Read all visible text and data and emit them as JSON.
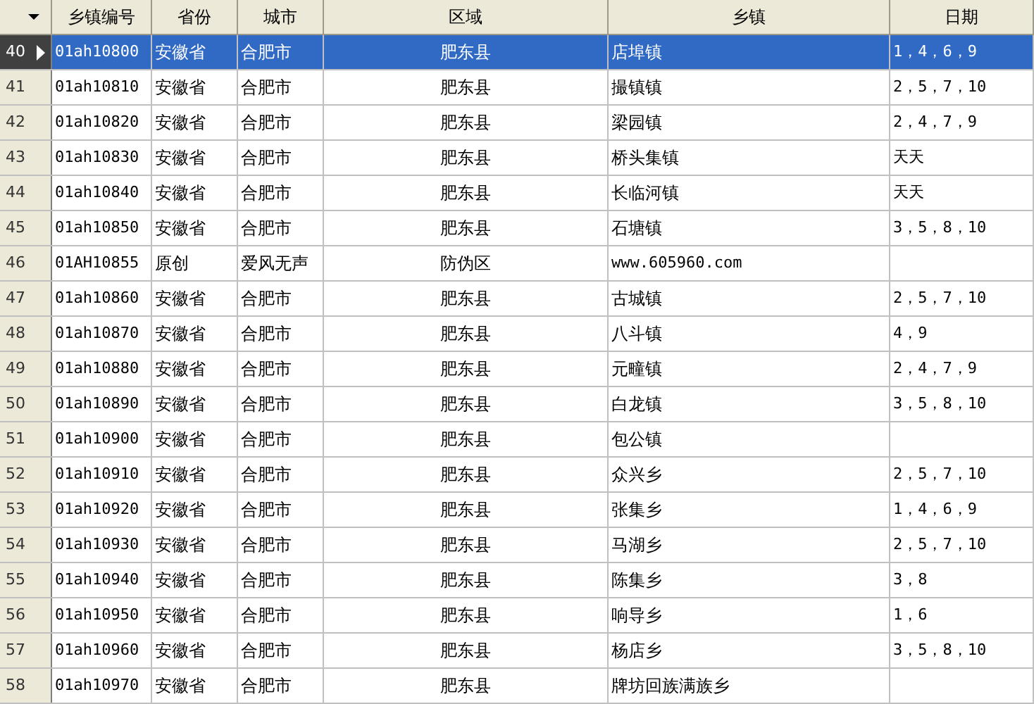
{
  "table": {
    "columns": [
      "乡镇编号",
      "省份",
      "城市",
      "区域",
      "乡镇",
      "日期"
    ],
    "rows": [
      {
        "number": "40",
        "selected": true,
        "cells": [
          "01ah10800",
          "安徽省",
          "合肥市",
          "肥东县",
          "店埠镇",
          "1，4，6，9"
        ]
      },
      {
        "number": "41",
        "selected": false,
        "cells": [
          "01ah10810",
          "安徽省",
          "合肥市",
          "肥东县",
          "撮镇镇",
          "2，5，7，10"
        ]
      },
      {
        "number": "42",
        "selected": false,
        "cells": [
          "01ah10820",
          "安徽省",
          "合肥市",
          "肥东县",
          "梁园镇",
          "2，4，7，9"
        ]
      },
      {
        "number": "43",
        "selected": false,
        "cells": [
          "01ah10830",
          "安徽省",
          "合肥市",
          "肥东县",
          "桥头集镇",
          "天天"
        ]
      },
      {
        "number": "44",
        "selected": false,
        "cells": [
          "01ah10840",
          "安徽省",
          "合肥市",
          "肥东县",
          "长临河镇",
          "天天"
        ]
      },
      {
        "number": "45",
        "selected": false,
        "cells": [
          "01ah10850",
          "安徽省",
          "合肥市",
          "肥东县",
          "石塘镇",
          "3，5，8，10"
        ]
      },
      {
        "number": "46",
        "selected": false,
        "cells": [
          "01AH10855",
          "原创",
          "爱风无声",
          "防伪区",
          "www.605960.com",
          ""
        ]
      },
      {
        "number": "47",
        "selected": false,
        "cells": [
          "01ah10860",
          "安徽省",
          "合肥市",
          "肥东县",
          "古城镇",
          "2，5，7，10"
        ]
      },
      {
        "number": "48",
        "selected": false,
        "cells": [
          "01ah10870",
          "安徽省",
          "合肥市",
          "肥东县",
          "八斗镇",
          "4，9"
        ]
      },
      {
        "number": "49",
        "selected": false,
        "cells": [
          "01ah10880",
          "安徽省",
          "合肥市",
          "肥东县",
          "元疃镇",
          "2，4，7，9"
        ]
      },
      {
        "number": "50",
        "selected": false,
        "cells": [
          "01ah10890",
          "安徽省",
          "合肥市",
          "肥东县",
          "白龙镇",
          "3，5，8，10"
        ]
      },
      {
        "number": "51",
        "selected": false,
        "cells": [
          "01ah10900",
          "安徽省",
          "合肥市",
          "肥东县",
          "包公镇",
          ""
        ]
      },
      {
        "number": "52",
        "selected": false,
        "cells": [
          "01ah10910",
          "安徽省",
          "合肥市",
          "肥东县",
          "众兴乡",
          "2，5，7，10"
        ]
      },
      {
        "number": "53",
        "selected": false,
        "cells": [
          "01ah10920",
          "安徽省",
          "合肥市",
          "肥东县",
          "张集乡",
          "1，4，6，9"
        ]
      },
      {
        "number": "54",
        "selected": false,
        "cells": [
          "01ah10930",
          "安徽省",
          "合肥市",
          "肥东县",
          "马湖乡",
          "2，5，7，10"
        ]
      },
      {
        "number": "55",
        "selected": false,
        "cells": [
          "01ah10940",
          "安徽省",
          "合肥市",
          "肥东县",
          "陈集乡",
          "3，8"
        ]
      },
      {
        "number": "56",
        "selected": false,
        "cells": [
          "01ah10950",
          "安徽省",
          "合肥市",
          "肥东县",
          "响导乡",
          "1，6"
        ]
      },
      {
        "number": "57",
        "selected": false,
        "cells": [
          "01ah10960",
          "安徽省",
          "合肥市",
          "肥东县",
          "杨店乡",
          "3，5，8，10"
        ]
      },
      {
        "number": "58",
        "selected": false,
        "cells": [
          "01ah10970",
          "安徽省",
          "合肥市",
          "肥东县",
          "牌坊回族满族乡",
          ""
        ]
      }
    ]
  }
}
